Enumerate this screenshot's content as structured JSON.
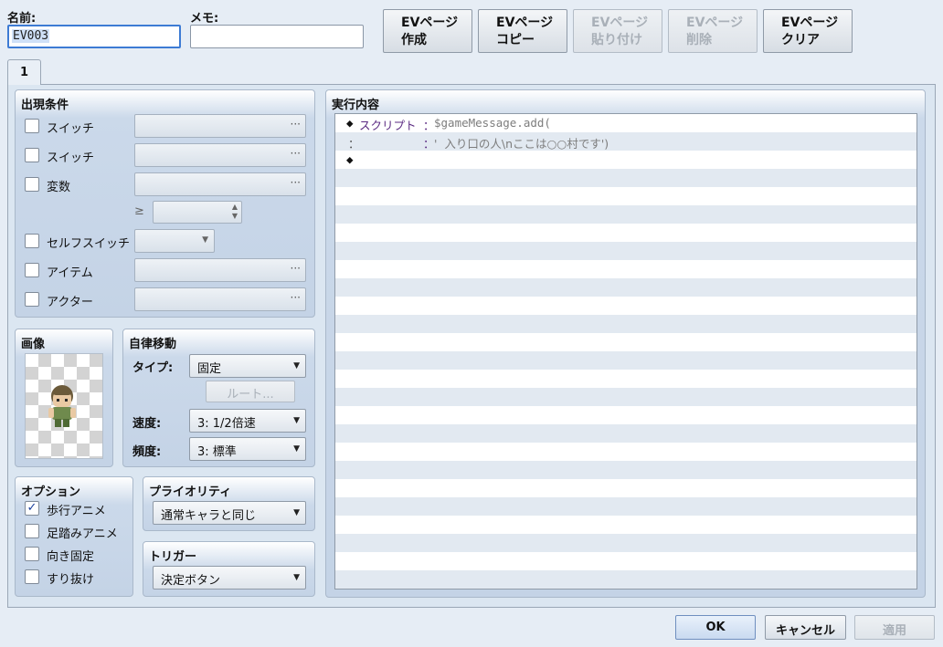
{
  "header": {
    "name_label": "名前:",
    "name_value": "EV003",
    "memo_label": "メモ:",
    "memo_value": ""
  },
  "ev_buttons": [
    {
      "line1": "EVページ",
      "line2": "作成",
      "enabled": true
    },
    {
      "line1": "EVページ",
      "line2": "コピー",
      "enabled": true
    },
    {
      "line1": "EVページ",
      "line2": "貼り付け",
      "enabled": false
    },
    {
      "line1": "EVページ",
      "line2": "削除",
      "enabled": false
    },
    {
      "line1": "EVページ",
      "line2": "クリア",
      "enabled": true
    }
  ],
  "tabs": [
    {
      "label": "1"
    }
  ],
  "conditions": {
    "title": "出現条件",
    "switch1_label": "スイッチ",
    "switch2_label": "スイッチ",
    "variable_label": "変数",
    "gte_symbol": "≥",
    "selfswitch_label": "セルフスイッチ",
    "item_label": "アイテム",
    "actor_label": "アクター",
    "dots": "···"
  },
  "image_group": {
    "title": "画像"
  },
  "autonomous": {
    "title": "自律移動",
    "type_label": "タイプ:",
    "type_value": "固定",
    "route_button": "ルート...",
    "speed_label": "速度:",
    "speed_value": "3: 1/2倍速",
    "freq_label": "頻度:",
    "freq_value": "3: 標準"
  },
  "options": {
    "title": "オプション",
    "items": [
      {
        "label": "歩行アニメ",
        "checked": true,
        "mark": "✓"
      },
      {
        "label": "足踏みアニメ",
        "checked": false,
        "mark": ""
      },
      {
        "label": "向き固定",
        "checked": false,
        "mark": ""
      },
      {
        "label": "すり抜け",
        "checked": false,
        "mark": ""
      }
    ]
  },
  "priority": {
    "title": "プライオリティ",
    "value": "通常キャラと同じ"
  },
  "trigger": {
    "title": "トリガー",
    "value": "決定ボタン"
  },
  "contents": {
    "title": "実行内容",
    "lines": [
      {
        "bullet": "◆",
        "keyword": "スクリプト",
        "sep": "：",
        "text": "$gameMessage.add("
      },
      {
        "bullet": "：",
        "keyword": "",
        "sep": "：",
        "text": "'  入り口の人\\nここは○○村です')"
      },
      {
        "bullet": "◆",
        "keyword": "",
        "sep": "",
        "text": ""
      }
    ],
    "keyword_color": "#5a2a82",
    "text_color": "#7d7d7d"
  },
  "footer": {
    "ok": "OK",
    "cancel": "キャンセル",
    "apply": "適用"
  },
  "icons": {
    "dropdown": "chevron-down-icon",
    "spinner": "spin-arrows-icon",
    "check": "checkmark-icon"
  }
}
